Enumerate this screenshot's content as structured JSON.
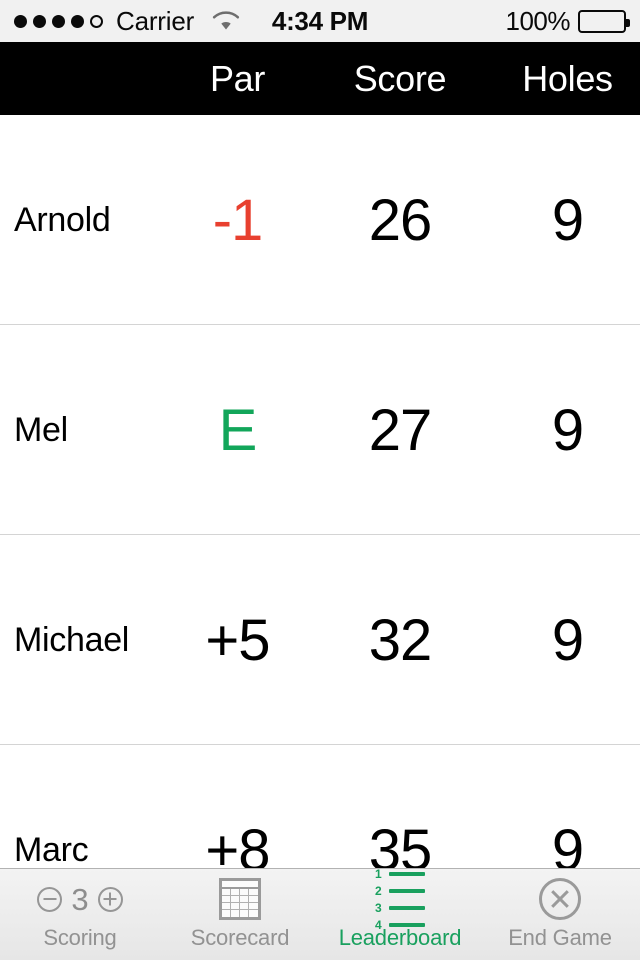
{
  "status_bar": {
    "signal_dots_filled": 4,
    "signal_dots_total": 5,
    "carrier": "Carrier",
    "wifi_icon": "wifi-icon",
    "time": "4:34 PM",
    "battery_percent": "100%",
    "battery_icon": "battery-full-icon"
  },
  "header": {
    "name_label": "",
    "par_label": "Par",
    "score_label": "Score",
    "holes_label": "Holes",
    "background": "#000000",
    "text_color": "#ffffff"
  },
  "colors": {
    "under_par": "#e8402f",
    "even_par": "#12a65a",
    "over_par": "#000000",
    "active_tab": "#19a05e",
    "inactive_tab": "#929292"
  },
  "leaderboard": {
    "rows": [
      {
        "name": "Arnold",
        "par": "-1",
        "par_state": "under",
        "score": "26",
        "holes": "9"
      },
      {
        "name": "Mel",
        "par": "E",
        "par_state": "even",
        "score": "27",
        "holes": "9"
      },
      {
        "name": "Michael",
        "par": "+5",
        "par_state": "over",
        "score": "32",
        "holes": "9"
      },
      {
        "name": "Marc",
        "par": "+8",
        "par_state": "over",
        "score": "35",
        "holes": "9"
      }
    ]
  },
  "tabbar": {
    "tabs": [
      {
        "label": "Scoring",
        "icon": "score-stepper-icon",
        "active": false,
        "stepper_value": "3"
      },
      {
        "label": "Scorecard",
        "icon": "grid-table-icon",
        "active": false
      },
      {
        "label": "Leaderboard",
        "icon": "numbered-list-icon",
        "active": true,
        "list_numbers": [
          "1",
          "2",
          "3",
          "4"
        ]
      },
      {
        "label": "End Game",
        "icon": "x-circle-icon",
        "active": false
      }
    ]
  }
}
